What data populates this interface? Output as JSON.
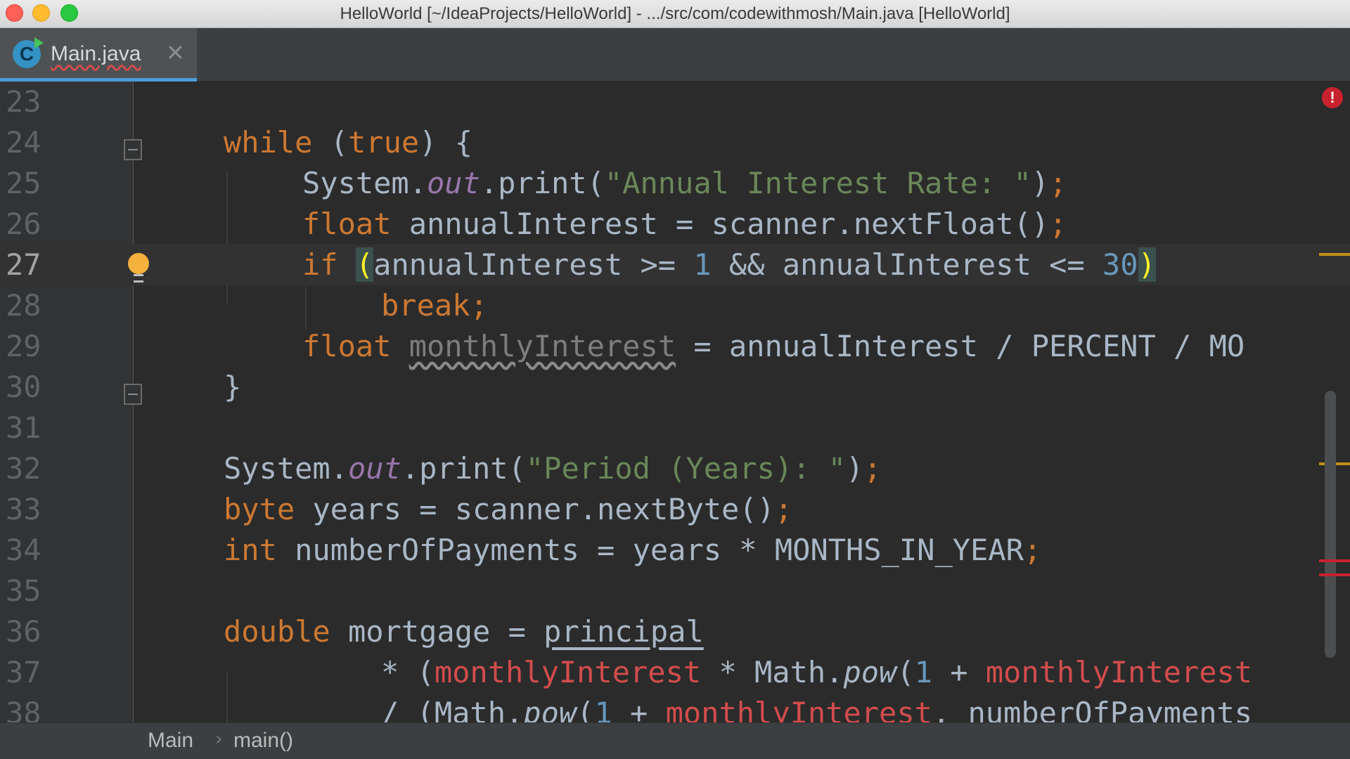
{
  "window": {
    "title": "HelloWorld [~/IdeaProjects/HelloWorld] - .../src/com/codewithmosh/Main.java [HelloWorld]"
  },
  "tab": {
    "label": "Main.java",
    "icon_letter": "C",
    "close_glyph": "✕"
  },
  "editor": {
    "current_line": 27,
    "error_badge": "!",
    "lines": [
      {
        "num": "23"
      },
      {
        "num": "24",
        "t": [
          "while",
          " (",
          "true",
          ") {"
        ]
      },
      {
        "num": "25",
        "t": [
          "System.",
          "out",
          ".print(",
          "\"Annual Interest Rate: \"",
          ")",
          ";"
        ]
      },
      {
        "num": "26",
        "t": [
          "float",
          " annualInterest = scanner.nextFloat()",
          ";"
        ]
      },
      {
        "num": "27",
        "t": [
          "if",
          " ",
          "(",
          "annualInterest >= ",
          "1",
          " && annualInterest <= ",
          "30",
          ")"
        ]
      },
      {
        "num": "28",
        "t": [
          "break",
          ";"
        ]
      },
      {
        "num": "29",
        "t": [
          "float",
          " ",
          "monthlyInterest",
          " = annualInterest / PERCENT / MO"
        ]
      },
      {
        "num": "30",
        "t": [
          "}"
        ]
      },
      {
        "num": "31"
      },
      {
        "num": "32",
        "t": [
          "System.",
          "out",
          ".print(",
          "\"Period (Years): \"",
          ")",
          ";"
        ]
      },
      {
        "num": "33",
        "t": [
          "byte",
          " years = scanner.nextByte()",
          ";"
        ]
      },
      {
        "num": "34",
        "t": [
          "int",
          " numberOfPayments = years * MONTHS_IN_YEAR",
          ";"
        ]
      },
      {
        "num": "35"
      },
      {
        "num": "36",
        "t": [
          "double",
          " mortgage = ",
          "principal"
        ]
      },
      {
        "num": "37",
        "t": [
          "* (",
          "monthlyInterest",
          " * Math.",
          "pow",
          "(",
          "1",
          " + ",
          "monthlyInterest"
        ]
      },
      {
        "num": "38",
        "t": [
          "/ (Math.",
          "pow",
          "(",
          "1",
          " + ",
          "monthlyInterest",
          ", numberOfPayments"
        ]
      }
    ]
  },
  "breadcrumbs": [
    "Main",
    "main()"
  ],
  "colors": {
    "keyword": "#cc7832",
    "string": "#6a8759",
    "number": "#6897bb",
    "field": "#9876aa",
    "error": "#d24c4c",
    "text": "#a9b7c6",
    "background": "#2b2b2b",
    "warning_mark": "#be9117",
    "error_mark": "#c7222d"
  }
}
